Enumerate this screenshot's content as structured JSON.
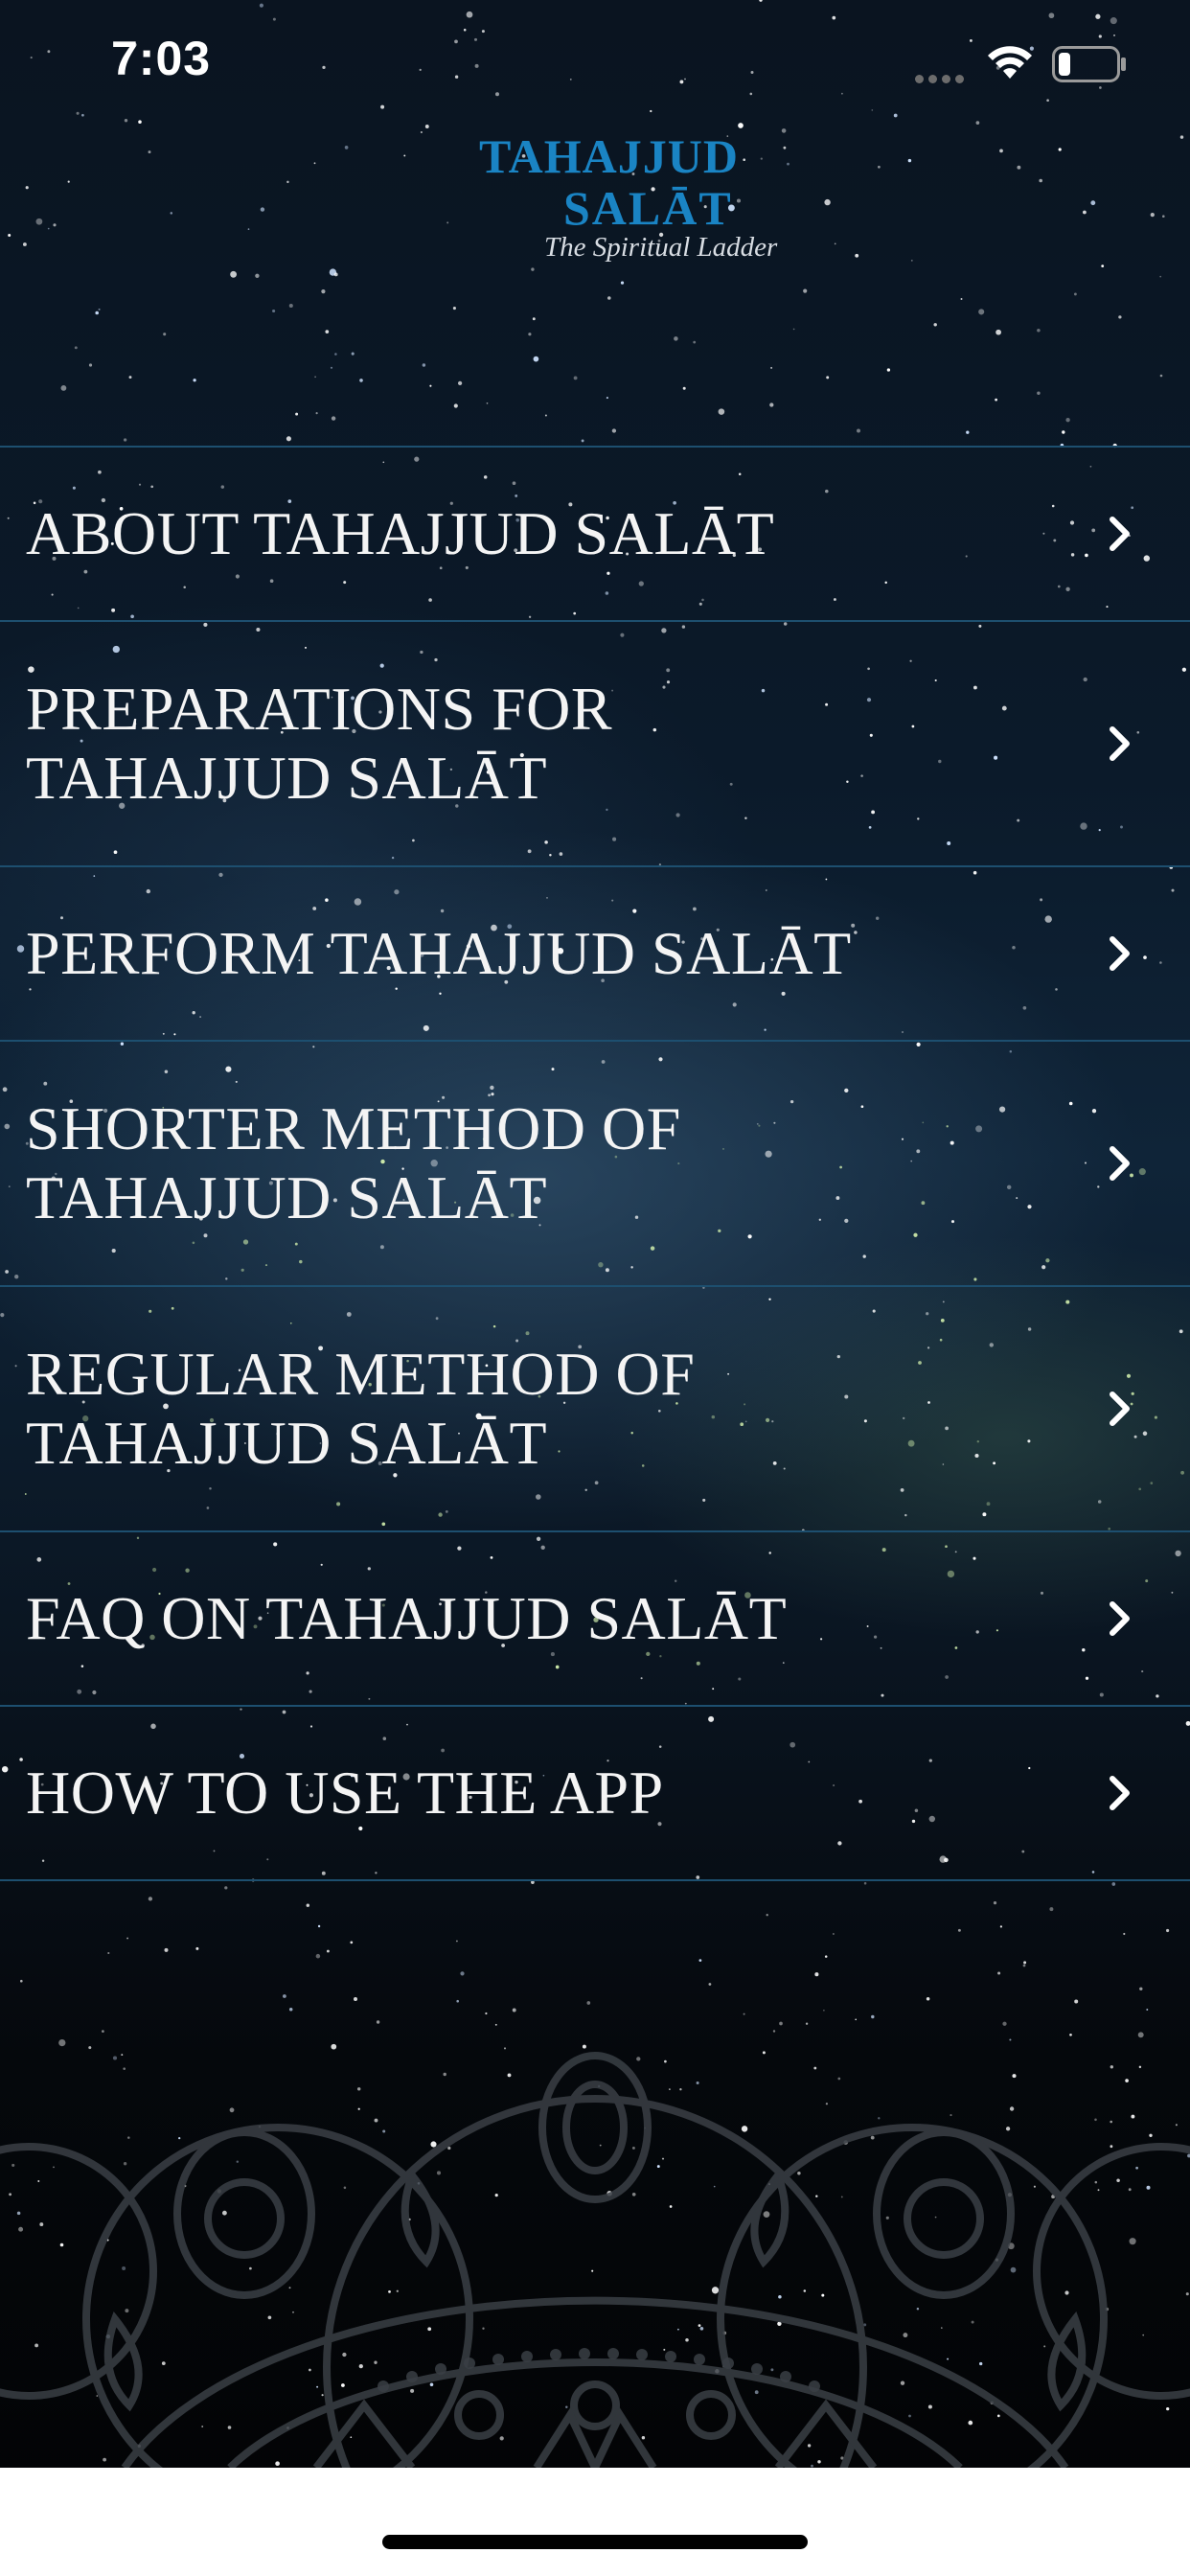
{
  "status_bar": {
    "time": "7:03"
  },
  "logo": {
    "line1": "TAHAJJUD",
    "line2": "SALĀT",
    "tagline": "The Spiritual Ladder",
    "color": "#1a84c4"
  },
  "menu": {
    "items": [
      {
        "label": "ABOUT TAHAJJUD SALĀT"
      },
      {
        "label": "PREPARATIONS FOR\nTAHAJJUD SALĀT"
      },
      {
        "label": "PERFORM TAHAJJUD SALĀT"
      },
      {
        "label": "SHORTER METHOD OF\nTAHAJJUD SALĀT"
      },
      {
        "label": "REGULAR METHOD OF\nTAHAJJUD SALĀT"
      },
      {
        "label": "FAQ ON TAHAJJUD SALĀT"
      },
      {
        "label": "HOW TO USE THE APP"
      }
    ],
    "chevron_icon": "chevron-right-icon",
    "divider_color": "#1d4f6f"
  }
}
